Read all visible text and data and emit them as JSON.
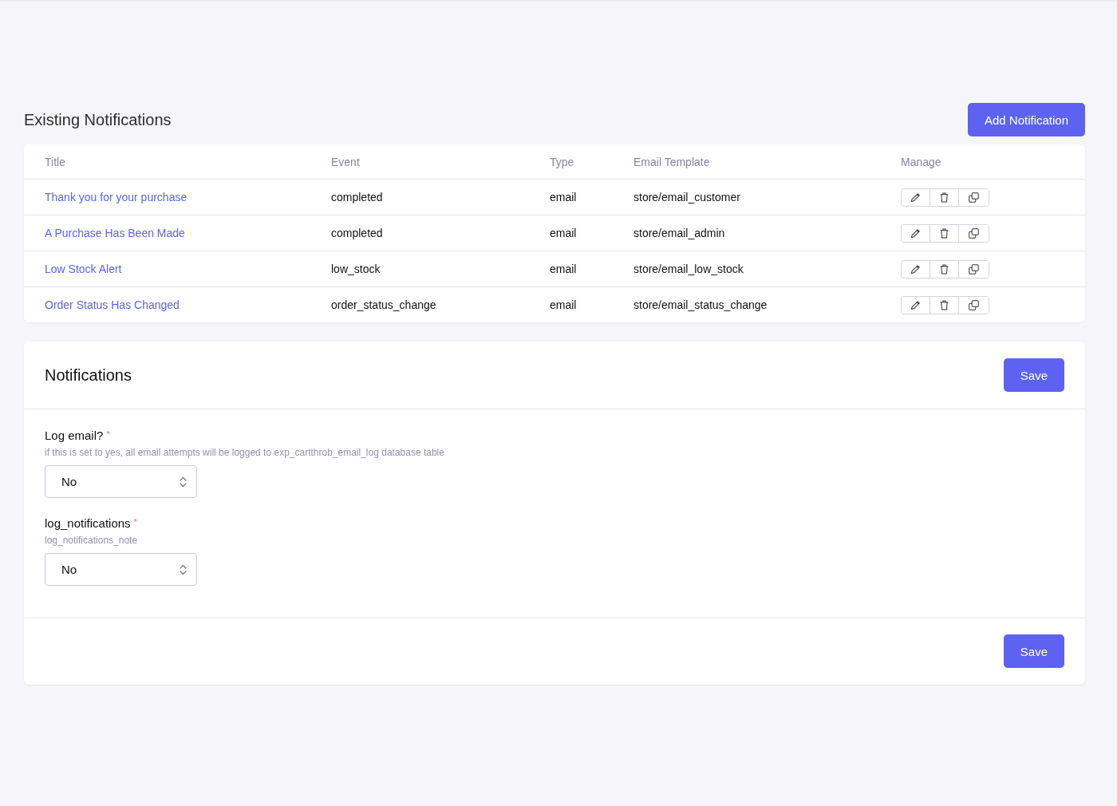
{
  "page_title": "Existing Notifications",
  "add_button": "Add Notification",
  "table": {
    "columns": [
      "Title",
      "Event",
      "Type",
      "Email Template",
      "Manage"
    ],
    "rows": [
      {
        "title": "Thank you for your purchase",
        "event": "completed",
        "type": "email",
        "email_template": "store/email_customer"
      },
      {
        "title": "A Purchase Has Been Made",
        "event": "completed",
        "type": "email",
        "email_template": "store/email_admin"
      },
      {
        "title": "Low Stock Alert",
        "event": "low_stock",
        "type": "email",
        "email_template": "store/email_low_stock"
      },
      {
        "title": "Order Status Has Changed",
        "event": "order_status_change",
        "type": "email",
        "email_template": "store/email_status_change"
      }
    ]
  },
  "settings": {
    "title": "Notifications",
    "save_button": "Save",
    "fields": [
      {
        "label": "Log email?",
        "required_mark": "*",
        "note": "if this is set to yes, all email attempts will be logged to exp_cartthrob_email_log database table",
        "value": "No"
      },
      {
        "label": "log_notifications",
        "required_mark": "*",
        "note": "log_notifications_note",
        "value": "No"
      }
    ],
    "footer_save_button": "Save"
  }
}
